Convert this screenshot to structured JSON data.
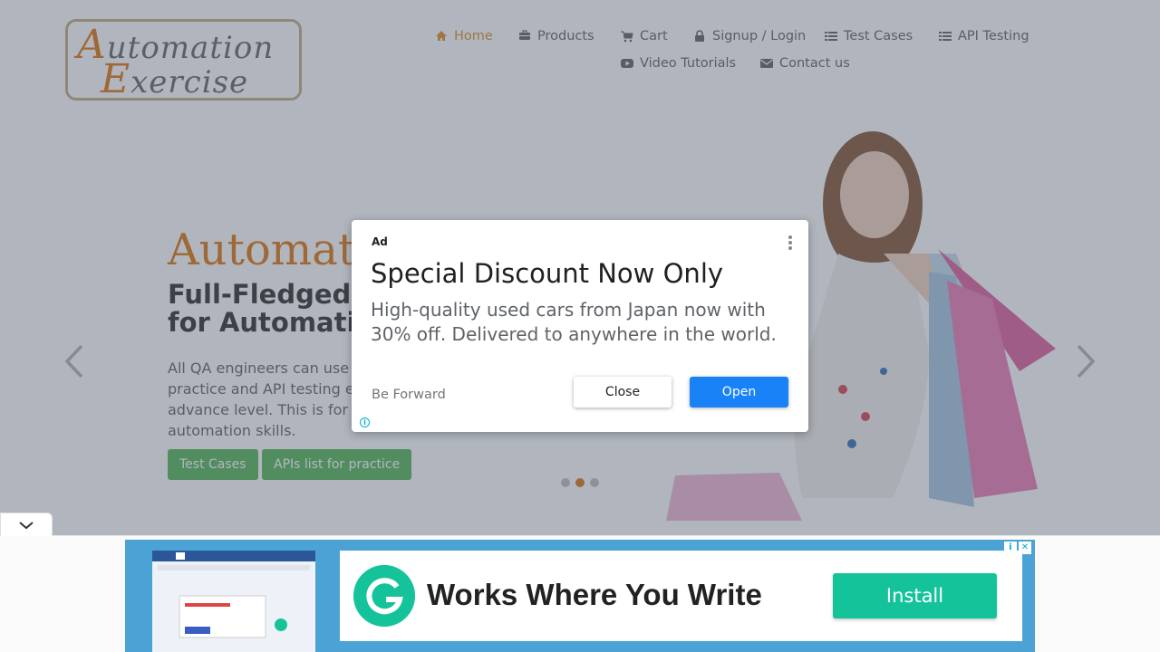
{
  "header": {
    "logo": {
      "line1_cap": "A",
      "line1_rest": "utomation",
      "line2_cap": "E",
      "line2_rest": "xercise"
    },
    "nav": [
      {
        "label": "Home",
        "icon": "home-icon"
      },
      {
        "label": "Products",
        "icon": "briefcase-icon"
      },
      {
        "label": "Cart",
        "icon": "cart-icon"
      },
      {
        "label": "Signup / Login",
        "icon": "lock-icon"
      },
      {
        "label": "Test Cases",
        "icon": "list-icon"
      },
      {
        "label": "API Testing",
        "icon": "list-icon"
      },
      {
        "label": "Video Tutorials",
        "icon": "youtube-icon"
      },
      {
        "label": "Contact us",
        "icon": "envelope-icon"
      }
    ],
    "active_color": "#e0902c"
  },
  "hero": {
    "title": "Automat",
    "subtitle_line1": "Full-Fledged",
    "subtitle_line2": "for Automatic",
    "description": "All QA engineers can use practice and API testing e advance level. This is for their automation skills.",
    "buttons": [
      "Test Cases",
      "APIs list for practice"
    ],
    "slide_dots": 3,
    "active_dot": 2
  },
  "ad_modal": {
    "badge": "Ad",
    "title": "Special Discount Now Only",
    "body": "High-quality used cars from Japan now with 30% off. Delivered to anywhere in the world.",
    "advertiser": "Be Forward",
    "close_label": "Close",
    "open_label": "Open",
    "info_glyph": "i"
  },
  "bottom_ad": {
    "headline": "Works Where You Write",
    "install_label": "Install",
    "brand_color": "#15c39a",
    "info_glyph": "i",
    "close_glyph": "✕"
  },
  "colors": {
    "accent": "#e07b18",
    "button_green": "#5cb85c",
    "open_blue": "#1a82f7"
  }
}
